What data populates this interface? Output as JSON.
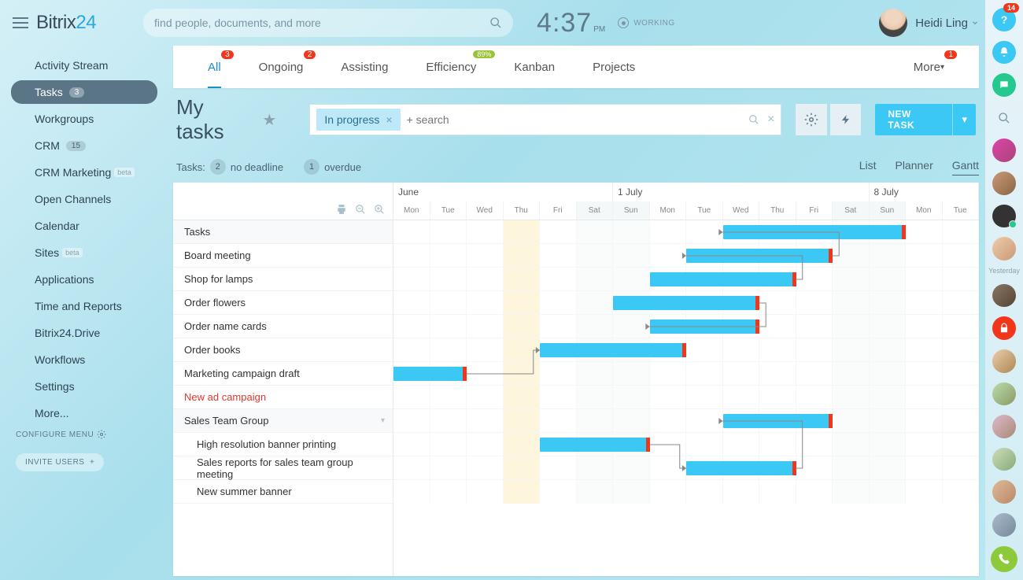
{
  "brand": {
    "a": "Bitrix",
    "b": "24"
  },
  "search": {
    "placeholder": "find people, documents, and more"
  },
  "clock": {
    "time": "4:37",
    "ampm": "PM",
    "status": "WORKING"
  },
  "user": {
    "name": "Heidi Ling"
  },
  "rail": {
    "help_badge": "14",
    "yesterday": "Yesterday"
  },
  "sidebar": {
    "items": [
      {
        "label": "Activity Stream"
      },
      {
        "label": "Tasks",
        "count": "3",
        "active": true
      },
      {
        "label": "Workgroups"
      },
      {
        "label": "CRM",
        "count": "15"
      },
      {
        "label": "CRM Marketing",
        "beta": "beta"
      },
      {
        "label": "Open Channels"
      },
      {
        "label": "Calendar"
      },
      {
        "label": "Sites",
        "beta": "beta"
      },
      {
        "label": "Applications"
      },
      {
        "label": "Time and Reports"
      },
      {
        "label": "Bitrix24.Drive"
      },
      {
        "label": "Workflows"
      },
      {
        "label": "Settings"
      },
      {
        "label": "More..."
      }
    ],
    "configure": "CONFIGURE MENU",
    "invite": "INVITE USERS"
  },
  "tabs": [
    {
      "label": "All",
      "badge": "3",
      "active": true
    },
    {
      "label": "Ongoing",
      "badge": "2"
    },
    {
      "label": "Assisting"
    },
    {
      "label": "Efficiency",
      "green": "89%"
    },
    {
      "label": "Kanban"
    },
    {
      "label": "Projects"
    }
  ],
  "tab_more": {
    "label": "More",
    "badge": "1"
  },
  "page": {
    "title": "My tasks",
    "chip": "In progress",
    "search_placeholder": "+ search",
    "new_task": "NEW TASK"
  },
  "info": {
    "tasks_label": "Tasks:",
    "no_deadline_count": "2",
    "no_deadline": "no deadline",
    "overdue_count": "1",
    "overdue": "overdue"
  },
  "views": {
    "list": "List",
    "planner": "Planner",
    "gantt": "Gantt"
  },
  "gantt": {
    "left_header": "Tasks",
    "months": [
      "June",
      "1 July",
      "8 July"
    ],
    "days": [
      "Mon",
      "Tue",
      "Wed",
      "Thu",
      "Fri",
      "Sat",
      "Sun",
      "Mon",
      "Tue",
      "Wed",
      "Thu",
      "Fri",
      "Sat",
      "Sun",
      "Mon",
      "Tue"
    ],
    "rows": [
      {
        "label": "Board meeting"
      },
      {
        "label": "Shop for lamps"
      },
      {
        "label": "Order flowers"
      },
      {
        "label": "Order name cards"
      },
      {
        "label": "Order books"
      },
      {
        "label": "Marketing campaign draft"
      },
      {
        "label": "New ad campaign",
        "red": true
      },
      {
        "label": "Sales Team Group",
        "group": true
      },
      {
        "label": "High resolution banner printing",
        "sub": true
      },
      {
        "label": "Sales reports for sales team group meeting",
        "sub": true
      },
      {
        "label": "New summer banner",
        "sub": true
      }
    ]
  },
  "chart_data": {
    "type": "gantt",
    "timeline_start": "2018-06-25",
    "timeline_end": "2018-07-10",
    "today": "2018-06-28",
    "tasks": [
      {
        "name": "Board meeting",
        "start": "2018-07-04",
        "end": "2018-07-08"
      },
      {
        "name": "Shop for lamps",
        "start": "2018-07-03",
        "end": "2018-07-06"
      },
      {
        "name": "Order flowers",
        "start": "2018-07-02",
        "end": "2018-07-05"
      },
      {
        "name": "Order name cards",
        "start": "2018-07-01",
        "end": "2018-07-04"
      },
      {
        "name": "Order books",
        "start": "2018-07-02",
        "end": "2018-07-04"
      },
      {
        "name": "Marketing campaign draft",
        "start": "2018-06-29",
        "end": "2018-07-02"
      },
      {
        "name": "New ad campaign",
        "start": "2018-06-25",
        "end": "2018-06-26"
      },
      {
        "name": "High resolution banner printing",
        "start": "2018-07-04",
        "end": "2018-07-06"
      },
      {
        "name": "Sales reports for sales team group meeting",
        "start": "2018-06-29",
        "end": "2018-07-01"
      },
      {
        "name": "New summer banner",
        "start": "2018-07-03",
        "end": "2018-07-05"
      }
    ],
    "dependencies": [
      [
        "New ad campaign",
        "Marketing campaign draft"
      ],
      [
        "Shop for lamps",
        "Board meeting"
      ],
      [
        "Order flowers",
        "Shop for lamps"
      ],
      [
        "Order name cards",
        "Order books"
      ],
      [
        "Sales reports for sales team group meeting",
        "New summer banner"
      ],
      [
        "New summer banner",
        "High resolution banner printing"
      ]
    ]
  }
}
